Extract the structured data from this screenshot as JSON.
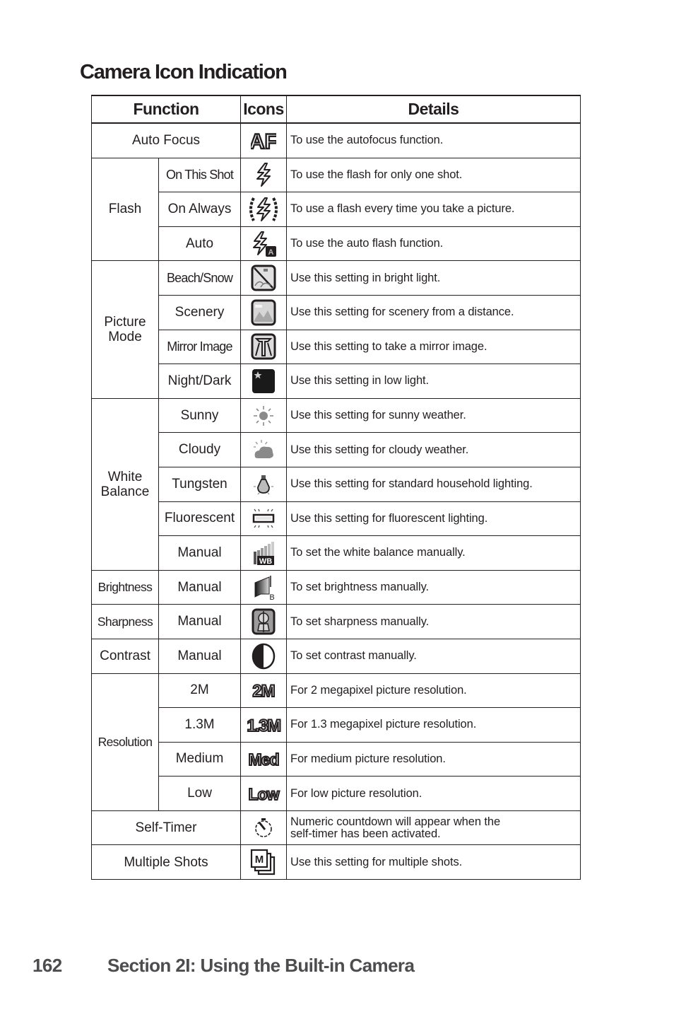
{
  "page": {
    "title": "Camera Icon Indication",
    "page_number": "162",
    "section_title": "Section 2I: Using the Built-in Camera"
  },
  "table": {
    "headers": {
      "function": "Function",
      "icons": "Icons",
      "details": "Details"
    },
    "groups": [
      {
        "function": "Auto Focus",
        "rows": [
          {
            "setting": "",
            "icon": "af-icon",
            "details": "To use the autofocus function."
          }
        ]
      },
      {
        "function": "Flash",
        "rows": [
          {
            "setting": "On This Shot",
            "icon": "flash-once-icon",
            "details": "To use the flash for only one shot."
          },
          {
            "setting": "On Always",
            "icon": "flash-always-icon",
            "details": "To use a flash every time you take a picture."
          },
          {
            "setting": "Auto",
            "icon": "flash-auto-icon",
            "details": "To use the auto flash function."
          }
        ]
      },
      {
        "function": "Picture Mode",
        "rows": [
          {
            "setting": "Beach/Snow",
            "icon": "beach-snow-icon",
            "details": "Use this setting in bright light."
          },
          {
            "setting": "Scenery",
            "icon": "scenery-icon",
            "details": "Use this setting for scenery from a distance."
          },
          {
            "setting": "Mirror Image",
            "icon": "mirror-image-icon",
            "details": "Use this setting to take a mirror image."
          },
          {
            "setting": "Night/Dark",
            "icon": "night-icon",
            "details": "Use this setting in low light."
          }
        ]
      },
      {
        "function": "White Balance",
        "rows": [
          {
            "setting": "Sunny",
            "icon": "sun-icon",
            "details": "Use this setting for sunny weather."
          },
          {
            "setting": "Cloudy",
            "icon": "cloud-icon",
            "details": "Use this setting for cloudy weather."
          },
          {
            "setting": "Tungsten",
            "icon": "bulb-icon",
            "details": "Use this setting for standard household lighting."
          },
          {
            "setting": "Fluorescent",
            "icon": "fluorescent-icon",
            "details": "Use this setting for fluorescent lighting."
          },
          {
            "setting": "Manual",
            "icon": "wb-manual-icon",
            "details": "To set the white balance manually."
          }
        ]
      },
      {
        "function": "Brightness",
        "rows": [
          {
            "setting": "Manual",
            "icon": "brightness-icon",
            "details": "To set brightness manually."
          }
        ]
      },
      {
        "function": "Sharpness",
        "rows": [
          {
            "setting": "Manual",
            "icon": "sharpness-icon",
            "details": "To set sharpness manually."
          }
        ]
      },
      {
        "function": "Contrast",
        "rows": [
          {
            "setting": "Manual",
            "icon": "contrast-icon",
            "details": "To set contrast manually."
          }
        ]
      },
      {
        "function": "Resolution",
        "rows": [
          {
            "setting": "2M",
            "icon": "res-2m-icon",
            "icon_text": "2M",
            "details": "For 2 megapixel picture resolution."
          },
          {
            "setting": "1.3M",
            "icon": "res-1-3m-icon",
            "icon_text": "1.3M",
            "details": "For 1.3 megapixel picture resolution."
          },
          {
            "setting": "Medium",
            "icon": "res-med-icon",
            "icon_text": "Med",
            "details": "For medium picture resolution."
          },
          {
            "setting": "Low",
            "icon": "res-low-icon",
            "icon_text": "Low",
            "details": "For low picture resolution."
          }
        ]
      },
      {
        "function": "Self-Timer",
        "rows": [
          {
            "setting": "",
            "icon": "self-timer-icon",
            "details_line1": "Numeric countdown will appear when the",
            "details_line2": "self-timer has been activated."
          }
        ]
      },
      {
        "function": "Multiple Shots",
        "rows": [
          {
            "setting": "",
            "icon": "multiple-shots-icon",
            "icon_text": "M",
            "details": "Use this setting for multiple shots."
          }
        ]
      }
    ]
  },
  "icon_labels": {
    "af": "AF",
    "flash_auto_badge": "A",
    "wb": "WB",
    "brightness_badge": "B"
  },
  "colors": {
    "text": "#231f20",
    "footer": "#4d4d4f",
    "border": "#231f20",
    "icon_gray": "#9a9a9a"
  }
}
